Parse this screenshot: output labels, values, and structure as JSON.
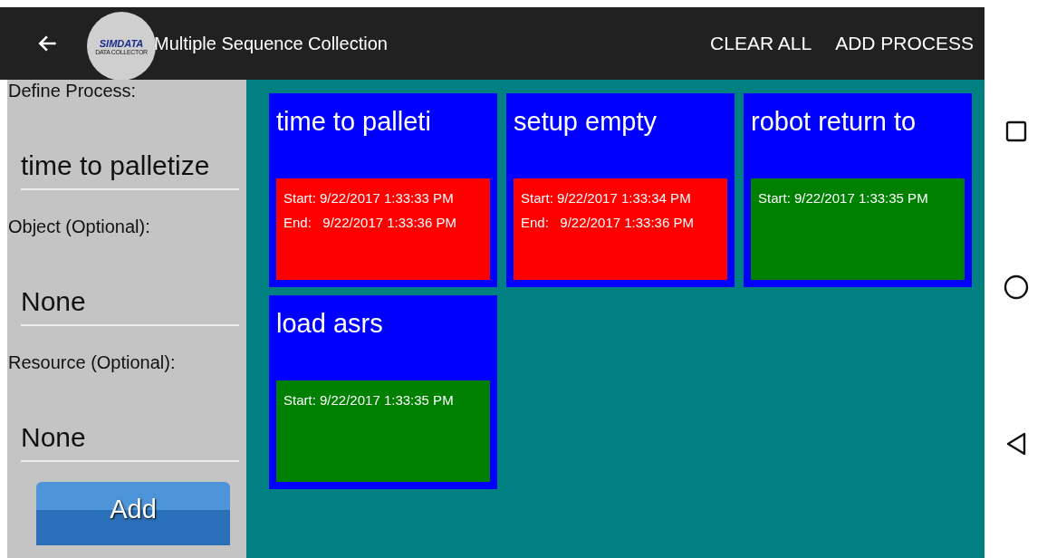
{
  "app_bar": {
    "title": "Multiple Sequence Collection",
    "logo": {
      "text": "SIMDATA",
      "subtitle": "DATA COLLECTOR"
    },
    "actions": [
      "CLEAR ALL",
      "ADD PROCESS"
    ]
  },
  "form": {
    "fields": [
      {
        "label": "Define Process:",
        "value": "time to palletize"
      },
      {
        "label": "Object (Optional):",
        "value": "None"
      },
      {
        "label": "Resource (Optional):",
        "value": "None"
      }
    ],
    "button": "Add"
  },
  "processes": [
    {
      "name": "time to palleti",
      "color": "#ff0000",
      "start": "Start: 9/22/2017 1:33:33 PM",
      "end": "End:   9/22/2017 1:33:36 PM"
    },
    {
      "name": "setup empty",
      "color": "#ff0000",
      "start": "Start: 9/22/2017 1:33:34 PM",
      "end": "End:   9/22/2017 1:33:36 PM"
    },
    {
      "name": "robot return to",
      "color": "#008000",
      "start": "Start: 9/22/2017 1:33:35 PM"
    },
    {
      "name": "load asrs",
      "color": "#008000",
      "start": "Start: 9/22/2017 1:33:35 PM"
    }
  ],
  "nav_bar": [
    {
      "kind": "recents"
    },
    {
      "kind": "home"
    },
    {
      "kind": "back"
    }
  ]
}
